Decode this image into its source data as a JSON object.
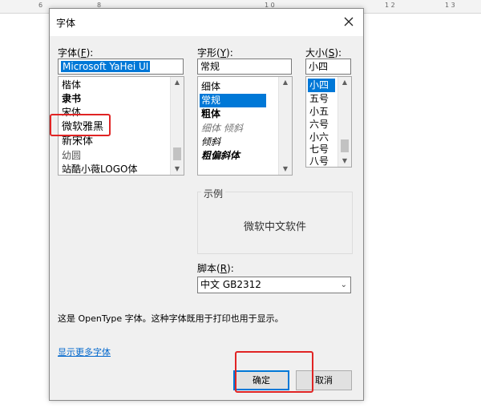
{
  "ruler": {
    "labels": [
      "6",
      "8",
      "1 0",
      "1 2",
      "1 3"
    ]
  },
  "dialog": {
    "title": "字体",
    "font": {
      "label": "字体(",
      "hotkey": "F",
      "label_end": "):",
      "value": "Microsoft YaHei UI",
      "items": [
        "楷体",
        "隶书",
        "宋体",
        "微软雅黑",
        "新宋体",
        "幼圆",
        "站酷小薇LOGO体"
      ]
    },
    "style": {
      "label": "字形(",
      "hotkey": "Y",
      "label_end": "):",
      "value": "常规",
      "items": [
        "细体",
        "常规",
        "粗体",
        "细体 倾斜",
        "倾斜",
        "粗偏斜体"
      ],
      "selected": "常规"
    },
    "size": {
      "label": "大小(",
      "hotkey": "S",
      "label_end": "):",
      "value": "小四",
      "items": [
        "小四",
        "五号",
        "小五",
        "六号",
        "小六",
        "七号",
        "八号"
      ],
      "selected": "小四"
    },
    "preview": {
      "caption": "示例",
      "text": "微软中文软件"
    },
    "script": {
      "label": "脚本(",
      "hotkey": "R",
      "label_end": "):",
      "value": "中文 GB2312"
    },
    "info_text": "这是 OpenType 字体。这种字体既用于打印也用于显示。",
    "more_fonts_link": "显示更多字体",
    "ok_label": "确定",
    "cancel_label": "取消"
  },
  "colors": {
    "accent": "#0078d7",
    "highlight": "#e02424"
  }
}
